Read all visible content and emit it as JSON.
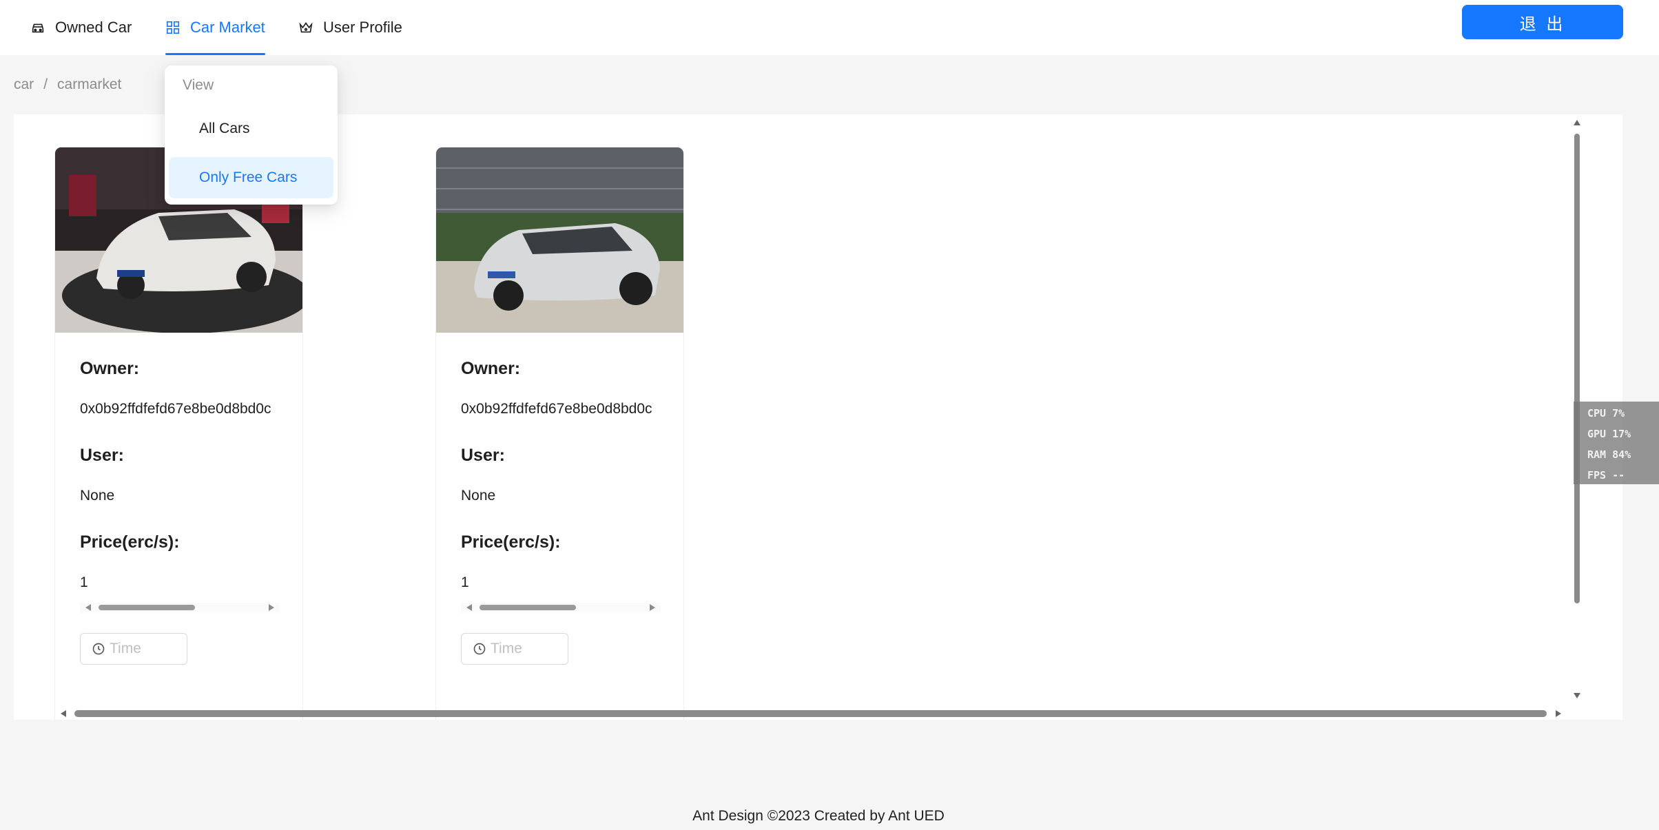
{
  "nav": {
    "items": [
      {
        "label": "Owned Car",
        "icon": "car-icon"
      },
      {
        "label": "Car Market",
        "icon": "appstore-icon"
      },
      {
        "label": "User Profile",
        "icon": "crown-icon"
      }
    ],
    "active": "Car Market",
    "logout_label": "退 出"
  },
  "breadcrumb": [
    "car",
    "carmarket"
  ],
  "dropdown": {
    "group_label": "View",
    "items": [
      "All Cars",
      "Only Free Cars"
    ],
    "selected": "Only Free Cars"
  },
  "cars": [
    {
      "image": "white-coupe-suv-showroom",
      "owner_label": "Owner:",
      "owner": "0x0b92ffdfefd67e8be0d8bd0c",
      "user_label": "User:",
      "user": "None",
      "price_label": "Price(erc/s):",
      "price": "1",
      "time_placeholder": "Time"
    },
    {
      "image": "silver-suv-outdoor",
      "owner_label": "Owner:",
      "owner": "0x0b92ffdfefd67e8be0d8bd0c",
      "user_label": "User:",
      "user": "None",
      "price_label": "Price(erc/s):",
      "price": "1",
      "time_placeholder": "Time"
    }
  ],
  "perf_overlay": {
    "cpu": "CPU  7%",
    "gpu": "GPU 17%",
    "ram": "RAM 84%",
    "fps": "FPS --"
  },
  "footer": "Ant Design ©2023 Created by Ant UED",
  "colors": {
    "primary": "#1677ff",
    "bg": "#f5f5f5",
    "selected_bg": "#e6f4ff"
  }
}
